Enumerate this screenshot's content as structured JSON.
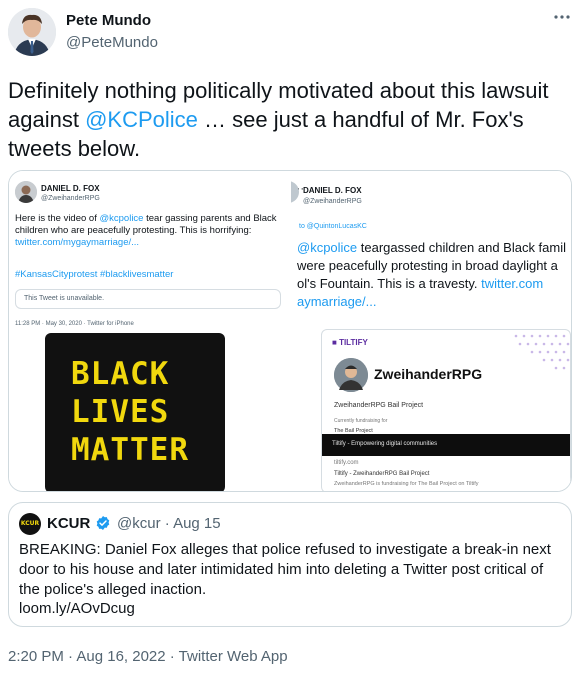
{
  "author": {
    "name": "Pete Mundo",
    "handle": "@PeteMundo"
  },
  "tweet": {
    "text_before": "Definitely nothing politically motivated about this lawsuit against ",
    "mention": "@KCPolice",
    "text_after": " … see just a handful of Mr. Fox's tweets below."
  },
  "media": {
    "left": {
      "name": "DANIEL D. FOX",
      "handle": "@ZweihanderRPG",
      "body_before": "Here is the video of ",
      "body_mention": "@kcpolice",
      "body_after": " tear gassing parents and Black children who are peacefully protesting. This is horrifying: ",
      "body_link": "twitter.com/mygaymarriage/...",
      "hashtags": "#KansasCityprotest #blacklivesmatter",
      "unavailable": "This Tweet is unavailable.",
      "meta": "11:28 PM · May 30, 2020 · Twitter for iPhone",
      "blm_line1": "BLACK",
      "blm_line2": "LIVES",
      "blm_line3": "MATTER"
    },
    "right": {
      "dots": "···",
      "name": "DANIEL D. FOX",
      "handle": "@ZweihanderRPG",
      "reply_to": "to @QuintonLucasKC",
      "line1_mention": "@kcpolice",
      "line1_text": " teargassed children and Black famil",
      "line2": "were peacefully protesting in broad daylight a",
      "line3_text": "ol's Fountain. This is a travesty. ",
      "line3_link": "twitter.com",
      "line4_link": "aymarriage/...",
      "card": {
        "brand": "TILTIFY",
        "title": "ZweihanderRPG",
        "subtitle": "ZweihanderRPG Bail Project",
        "fund_label": "Currently fundraising for",
        "fund_name": "The Bail Project",
        "bar_text": "Tiltify - Empowering digital communities",
        "domain": "tiltify.com",
        "desc_title": "Tiltify - ZweihanderRPG Bail Project",
        "desc": "ZweihanderRPG is fundraising for The Bail Project on Tiltify"
      }
    }
  },
  "quote": {
    "avatar_text": "KCUR",
    "name": "KCUR",
    "handle_date": "@kcur · Aug 15",
    "text": "BREAKING: Daniel Fox alleges that police refused to investigate a break-in next door to his house and later intimidated him into deleting a Twitter post critical of the police's alleged inaction.",
    "link": "loom.ly/AOvDcug"
  },
  "timestamp": "2:20 PM · Aug 16, 2022 · Twitter Web App",
  "colors": {
    "accent": "#1d9bf0",
    "secondary_text": "#536471",
    "blm_yellow": "#f1d80e"
  }
}
